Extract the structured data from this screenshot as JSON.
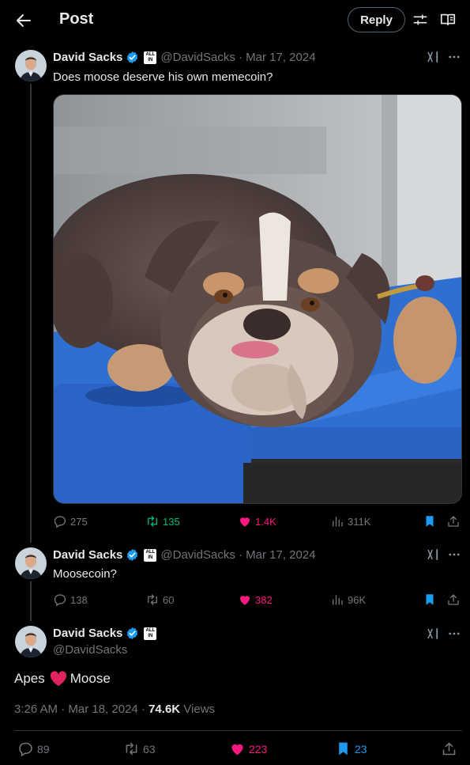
{
  "header": {
    "title": "Post",
    "reply_label": "Reply"
  },
  "author": {
    "name": "David Sacks",
    "handle": "@DavidSacks",
    "affiliate_badge_text": "ALL IN"
  },
  "tweets": [
    {
      "meta": "@DavidSacks · Mar 17, 2024",
      "text": "Does moose deserve his own memecoin?",
      "stats": {
        "replies": "275",
        "retweets": "135",
        "likes": "1.4K",
        "views": "311K"
      }
    },
    {
      "meta": "@DavidSacks · Mar 17, 2024",
      "text": "Moosecoin?",
      "stats": {
        "replies": "138",
        "retweets": "60",
        "likes": "382",
        "views": "96K"
      }
    }
  ],
  "main_tweet": {
    "handle": "@DavidSacks",
    "text_before": "Apes",
    "emoji": "red-heart",
    "text_after": "Moose",
    "time": "3:26 AM · Mar 18, 2024 · ",
    "views_count": "74.6K",
    "views_label": " Views",
    "stats": {
      "replies": "89",
      "retweets": "63",
      "likes": "223",
      "bookmarks": "23"
    }
  },
  "colors": {
    "background": "#000000",
    "text": "#e7e9ea",
    "muted": "#71767b",
    "retweet": "#00ba7c",
    "like": "#f91880",
    "accent": "#1d9bf0"
  },
  "icons": [
    "back-arrow-icon",
    "sliders-icon",
    "reader-icon",
    "verified-icon",
    "grok-icon",
    "more-icon",
    "reply-icon",
    "retweet-icon",
    "like-icon",
    "views-icon",
    "bookmark-icon",
    "share-icon"
  ]
}
